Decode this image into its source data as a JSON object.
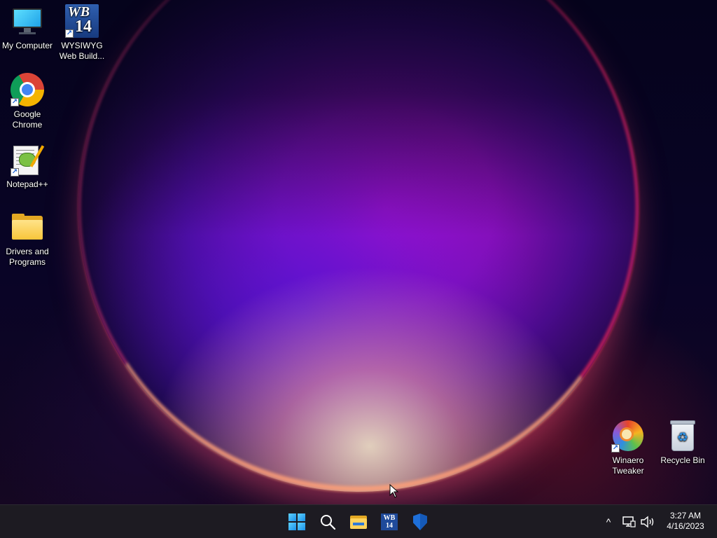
{
  "desktop": {
    "icons": [
      {
        "label": "My Computer"
      },
      {
        "label": "WYSIWYG Web Build..."
      },
      {
        "label": "Google Chrome"
      },
      {
        "label": "Notepad++"
      },
      {
        "label": "Drivers and Programs"
      },
      {
        "label": "Winaero Tweaker"
      },
      {
        "label": "Recycle Bin"
      }
    ],
    "wb_badge": {
      "line1": "WB",
      "line2": "14"
    }
  },
  "taskbar": {
    "pinned": [
      {
        "icon": "windows-start-icon"
      },
      {
        "icon": "search-icon"
      },
      {
        "icon": "file-explorer-icon"
      },
      {
        "icon": "wysiwyg-web-builder-icon",
        "badge": "WB 14"
      },
      {
        "icon": "windows-security-icon"
      }
    ],
    "tray": {
      "chevron": "^",
      "icons": [
        "network-icon",
        "volume-icon"
      ]
    },
    "clock": {
      "time": "3:27 AM",
      "date": "4/16/2023"
    }
  },
  "colors": {
    "taskbar_bg": "#1d1b22",
    "accent_blue": "#1a8fe8",
    "wallpaper_dark": "#05031c",
    "wallpaper_orb": "#b010c8"
  }
}
